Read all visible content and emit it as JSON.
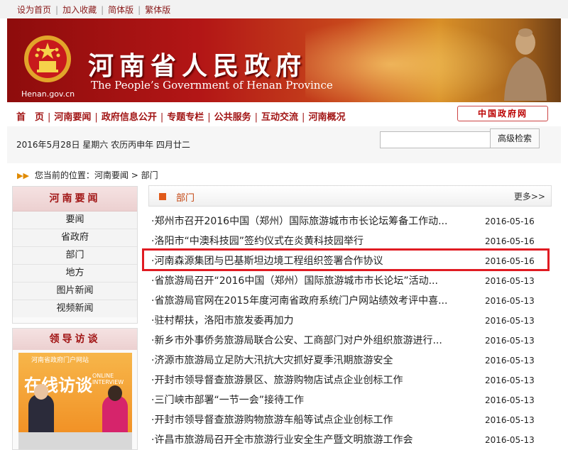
{
  "toplinks": [
    "设为首页",
    "加入收藏",
    "简体版",
    "繁体版"
  ],
  "banner": {
    "title_cn": "河南省人民政府",
    "title_en": "The People’s Government of Henan Province",
    "domain": "Henan.gov.cn"
  },
  "nav": {
    "items": [
      "首　页",
      "河南要闻",
      "政府信息公开",
      "专题专栏",
      "公共服务",
      "互动交流",
      "河南概况"
    ],
    "gov_link": "中国政府网"
  },
  "date_text": "2016年5月28日 星期六 农历丙申年  四月廿二",
  "search": {
    "placeholder": "",
    "button": "高级检索"
  },
  "breadcrumb": {
    "prefix": "您当前的位置：",
    "path": "河南要闻 > 部门"
  },
  "sidebar": {
    "title": "河南要闻",
    "items": [
      "要闻",
      "省政府",
      "部门",
      "地方",
      "图片新闻",
      "视频新闻"
    ]
  },
  "visit": {
    "title": "领导访谈",
    "site_name": "河南省政府门户网站",
    "caption": "在线访谈",
    "caption_en": "ONLINE INTERVIEW"
  },
  "panel": {
    "title": "部门",
    "more": "更多>>"
  },
  "news": [
    {
      "title": "·郑州市召开2016中国（郑州）国际旅游城市市长论坛筹备工作动...",
      "date": "2016-05-16"
    },
    {
      "title": "·洛阳市“中澳科技园”签约仪式在炎黄科技园举行",
      "date": "2016-05-16"
    },
    {
      "title": "·河南森源集团与巴基斯坦边境工程组织签署合作协议",
      "date": "2016-05-16"
    },
    {
      "title": "·省旅游局召开“2016中国（郑州）国际旅游城市市长论坛”活动...",
      "date": "2016-05-13"
    },
    {
      "title": "·省旅游局官网在2015年度河南省政府系统门户网站绩效考评中喜...",
      "date": "2016-05-13"
    },
    {
      "title": "·驻村帮扶，洛阳市旅发委再加力",
      "date": "2016-05-13"
    },
    {
      "title": "·新乡市外事侨务旅游局联合公安、工商部门对户外组织旅游进行...",
      "date": "2016-05-13"
    },
    {
      "title": "·济源市旅游局立足防大汛抗大灾抓好夏季汛期旅游安全",
      "date": "2016-05-13"
    },
    {
      "title": "·开封市领导督查旅游景区、旅游购物店试点企业创标工作",
      "date": "2016-05-13"
    },
    {
      "title": "·三门峡市部署“一节一会”接待工作",
      "date": "2016-05-13"
    },
    {
      "title": "·开封市领导督查旅游购物旅游车船等试点企业创标工作",
      "date": "2016-05-13"
    },
    {
      "title": "·许昌市旅游局召开全市旅游行业安全生产暨文明旅游工作会",
      "date": "2016-05-13"
    }
  ],
  "colors": {
    "brand_red": "#a11414",
    "highlight": "#e01b22",
    "accent_orange": "#e05a1a"
  }
}
